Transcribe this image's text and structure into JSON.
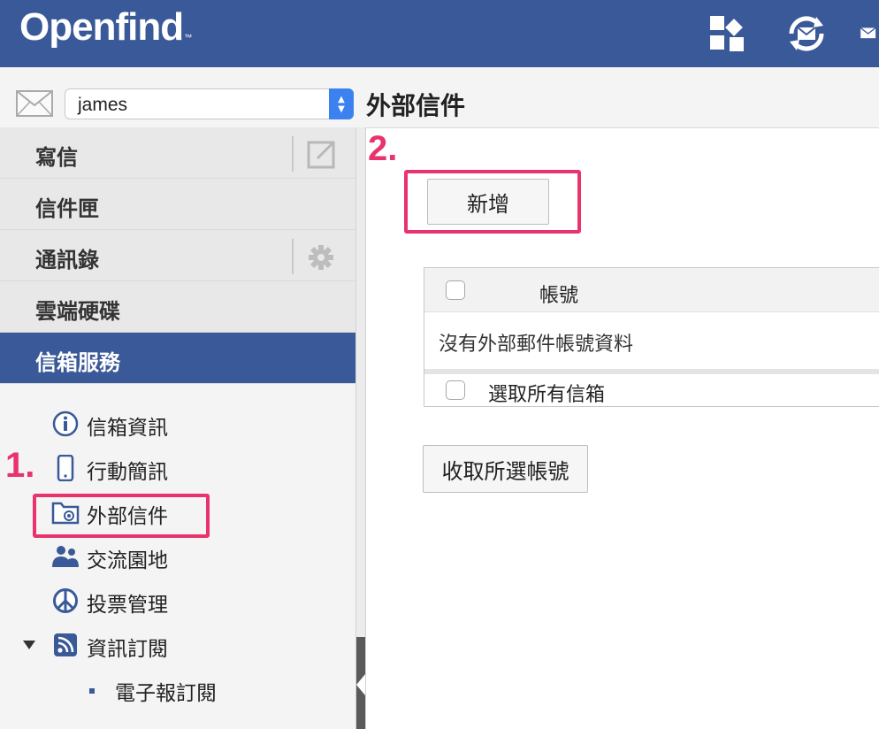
{
  "header": {
    "logo_text": "Openfind",
    "logo_tm": "™",
    "icons": [
      "modules-icon",
      "sync-mail-icon",
      "mail-partial-icon"
    ]
  },
  "account": {
    "selected": "james",
    "icon": "envelope-icon"
  },
  "page": {
    "title": "外部信件"
  },
  "sidebar": {
    "nav": [
      {
        "label": "寫信",
        "side_icon": "popout-icon"
      },
      {
        "label": "信件匣"
      },
      {
        "label": "通訊錄",
        "side_icon": "gear-icon"
      },
      {
        "label": "雲端硬碟"
      },
      {
        "label": "信箱服務",
        "active": true
      }
    ],
    "sub_items": [
      {
        "label": "信箱資訊",
        "icon": "info-icon"
      },
      {
        "label": "行動簡訊",
        "icon": "mobile-icon"
      },
      {
        "label": "外部信件",
        "icon": "folder-at-icon",
        "selected": true
      },
      {
        "label": "交流園地",
        "icon": "users-icon"
      },
      {
        "label": "投票管理",
        "icon": "vote-icon"
      },
      {
        "label": "資訊訂閱",
        "icon": "rss-icon",
        "expanded": true
      }
    ],
    "child_items": [
      {
        "label": "電子報訂閱"
      }
    ]
  },
  "main": {
    "add_button": "新增",
    "table": {
      "column_header": "帳號",
      "empty_message": "沒有外部郵件帳號資料",
      "select_all_label": "選取所有信箱"
    },
    "fetch_button": "收取所選帳號"
  },
  "annotations": {
    "step1": "1.",
    "step2": "2."
  },
  "colors": {
    "brand_blue": "#3a5998",
    "annotation_pink": "#e8336d",
    "select_accent": "#3b82f0"
  }
}
